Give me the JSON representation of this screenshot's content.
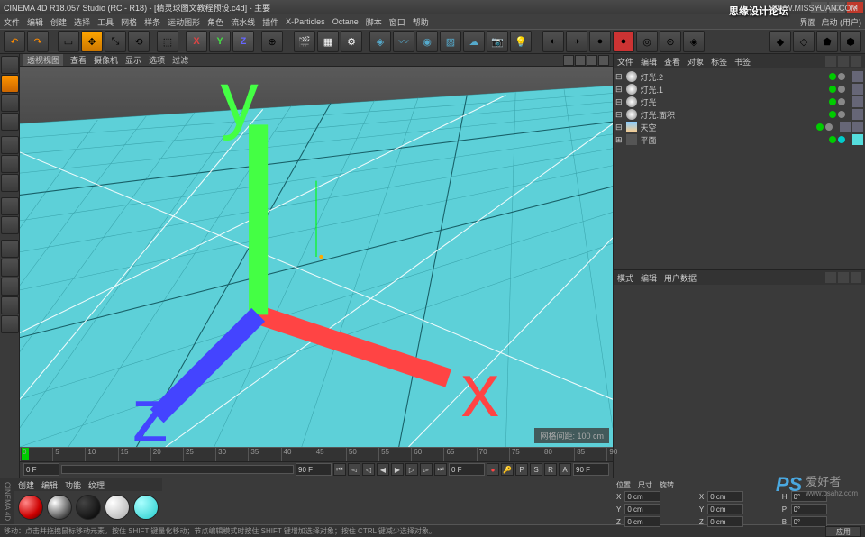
{
  "watermarks": {
    "top1": "思缘设计论坛",
    "top2": "WWW.MISSYUAN.COM",
    "bottomLogo": "PS",
    "bottomText": "爱好者",
    "bottomUrl": "www.psahz.com"
  },
  "title": "CINEMA 4D R18.057 Studio (RC - R18) - [精灵球图文教程预设.c4d] - 主要",
  "menu": [
    "文件",
    "编辑",
    "创建",
    "选择",
    "工具",
    "网格",
    "样条",
    "运动图形",
    "角色",
    "流水线",
    "插件",
    "X-Particles",
    "Octane",
    "脚本",
    "窗口",
    "帮助"
  ],
  "layout": {
    "l1": "界面",
    "l2": "启动 (用户)"
  },
  "viewportMenu": [
    "查看",
    "摄像机",
    "显示",
    "选项",
    "过滤"
  ],
  "vpInfo": "网格间距: 100 cm",
  "vpTab": "透视视图",
  "timeline": {
    "ticks": [
      "0",
      "5",
      "10",
      "15",
      "20",
      "25",
      "30",
      "35",
      "40",
      "45",
      "50",
      "55",
      "60",
      "65",
      "70",
      "75",
      "80",
      "85",
      "90"
    ],
    "startF": "0 F",
    "endF": "90 F",
    "cur": "0 F",
    "end2": "90 F"
  },
  "objPanel": {
    "tabs": [
      "文件",
      "编辑",
      "查看",
      "对象",
      "标签",
      "书签"
    ],
    "items": [
      {
        "name": "灯光.2",
        "type": "light"
      },
      {
        "name": "灯光.1",
        "type": "light"
      },
      {
        "name": "灯光",
        "type": "light"
      },
      {
        "name": "灯光.面积",
        "type": "light"
      },
      {
        "name": "天空",
        "type": "sky"
      },
      {
        "name": "平面",
        "type": "null"
      }
    ]
  },
  "attrPanel": {
    "tabs": [
      "模式",
      "编辑",
      "用户数据"
    ]
  },
  "matPanel": {
    "tabs": [
      "创建",
      "编辑",
      "功能",
      "纹理"
    ]
  },
  "coords": {
    "tabs": [
      "位置",
      "尺寸",
      "旋转"
    ],
    "x": "0 cm",
    "sx": "0 cm",
    "h": "0°",
    "y": "0 cm",
    "sy": "0 cm",
    "p": "0°",
    "z": "0 cm",
    "sz": "0 cm",
    "b": "0°",
    "apply": "应用"
  },
  "status": "移动：点击并拖拽鼠标移动元素。按住 SHIFT 键量化移动；节点编辑模式时按住 SHIFT 键增加选择对象；按住 CTRL 键减少选择对象。",
  "verticalLabel": "CINEMA 4D",
  "axisLabels": {
    "x": "X",
    "y": "Y",
    "z": "Z"
  }
}
